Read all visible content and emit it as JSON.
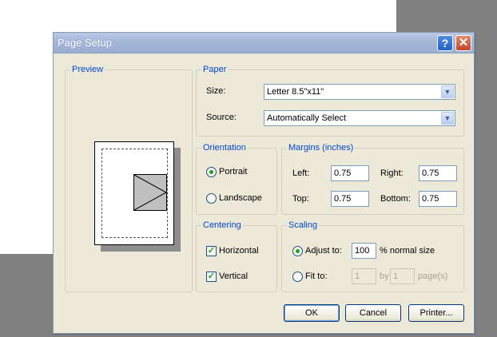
{
  "window": {
    "title": "Page Setup",
    "help_glyph": "?",
    "close_glyph": "✕"
  },
  "preview": {
    "legend": "Preview"
  },
  "paper": {
    "legend": "Paper",
    "size_label": "Size:",
    "size_value": "Letter 8.5\"x11\"",
    "source_label": "Source:",
    "source_value": "Automatically Select"
  },
  "orientation": {
    "legend": "Orientation",
    "portrait_label": "Portrait",
    "landscape_label": "Landscape",
    "selected": "Portrait"
  },
  "margins": {
    "legend": "Margins (inches)",
    "left_label": "Left:",
    "left_value": "0.75",
    "right_label": "Right:",
    "right_value": "0.75",
    "top_label": "Top:",
    "top_value": "0.75",
    "bottom_label": "Bottom:",
    "bottom_value": "0.75"
  },
  "centering": {
    "legend": "Centering",
    "horizontal_label": "Horizontal",
    "horizontal_checked": true,
    "vertical_label": "Vertical",
    "vertical_checked": true
  },
  "scaling": {
    "legend": "Scaling",
    "adjust_label": "Adjust to:",
    "adjust_value": "100",
    "adjust_suffix": "% normal size",
    "fit_label": "Fit to:",
    "fit_wide_value": "1",
    "fit_by_label": "by",
    "fit_tall_value": "1",
    "fit_suffix": "page(s)"
  },
  "buttons": {
    "ok": "OK",
    "cancel": "Cancel",
    "printer": "Printer..."
  },
  "icons": {
    "dropdown": "▼",
    "check": "✓"
  }
}
